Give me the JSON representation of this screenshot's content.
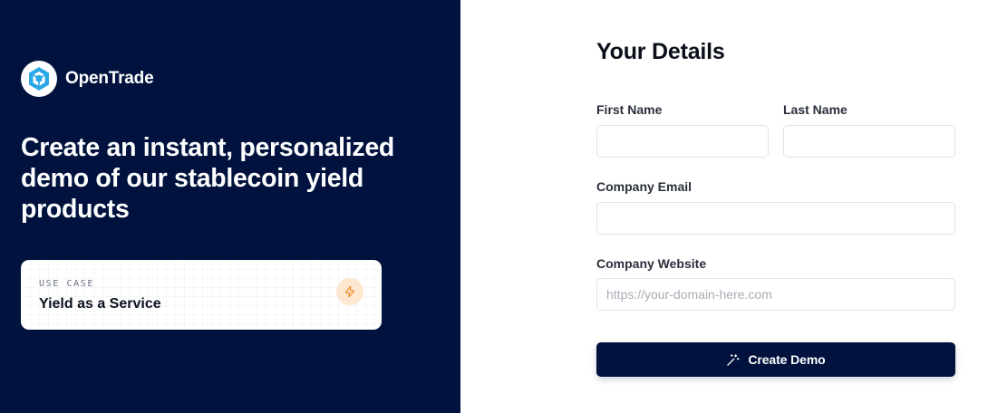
{
  "brand": {
    "name": "OpenTrade",
    "logo_icon": "opentrade-cube-logo",
    "accent_color": "#2aa8e6"
  },
  "hero": {
    "headline": "Create an instant, personalized demo of our stablecoin yield products"
  },
  "use_case": {
    "label": "USE CASE",
    "value": "Yield as a Service",
    "icon": "lightning-bolt-icon",
    "icon_color": "#f08a24"
  },
  "form": {
    "title": "Your Details",
    "first_name": {
      "label": "First Name",
      "value": "",
      "placeholder": ""
    },
    "last_name": {
      "label": "Last Name",
      "value": "",
      "placeholder": ""
    },
    "company_email": {
      "label": "Company Email",
      "value": "",
      "placeholder": ""
    },
    "company_website": {
      "label": "Company Website",
      "value": "",
      "placeholder": "https://your-domain-here.com"
    },
    "submit": {
      "label": "Create Demo",
      "icon": "magic-wand-icon"
    }
  },
  "colors": {
    "navy": "#00123d",
    "white": "#ffffff",
    "border": "#dfe3e8"
  }
}
